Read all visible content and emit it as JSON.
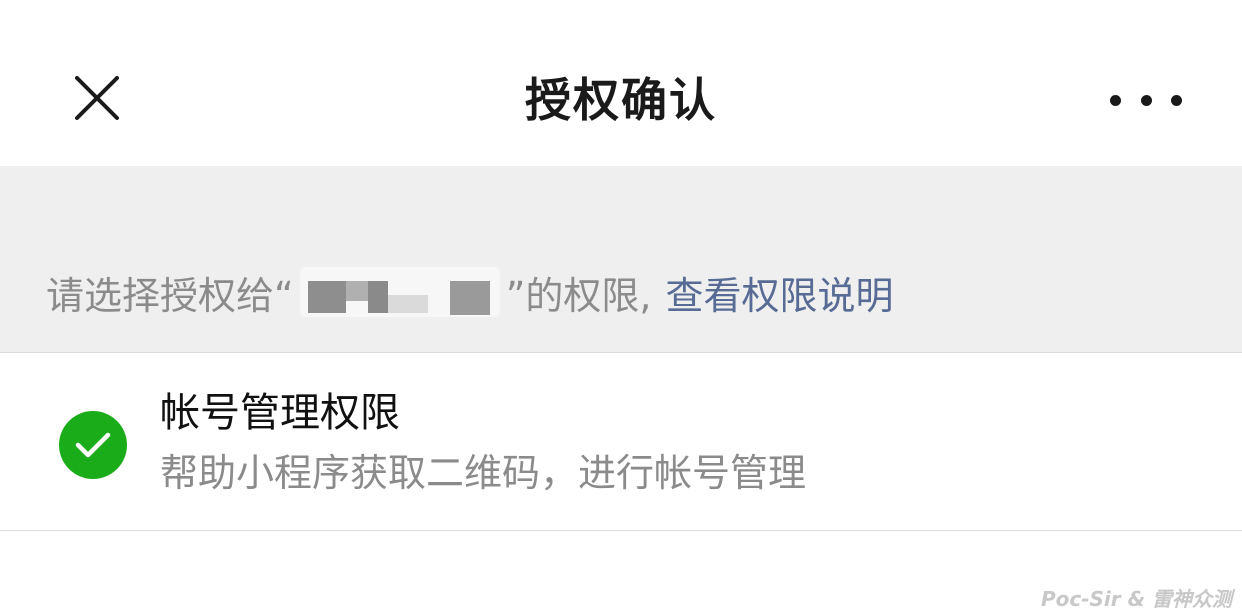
{
  "navbar": {
    "title": "授权确认",
    "close_icon": "close-icon",
    "more_icon": "more-dots-icon"
  },
  "prompt": {
    "text_before": "请选择授权给“",
    "text_after": "”的权限,",
    "link_label": "查看权限说明",
    "link_color": "#576b95"
  },
  "permission": {
    "title": "帐号管理权限",
    "description": "帮助小程序获取二维码，进行帐号管理",
    "checked": true,
    "check_color": "#1aad19"
  },
  "watermark": "Poc-Sir & 雷神众测"
}
